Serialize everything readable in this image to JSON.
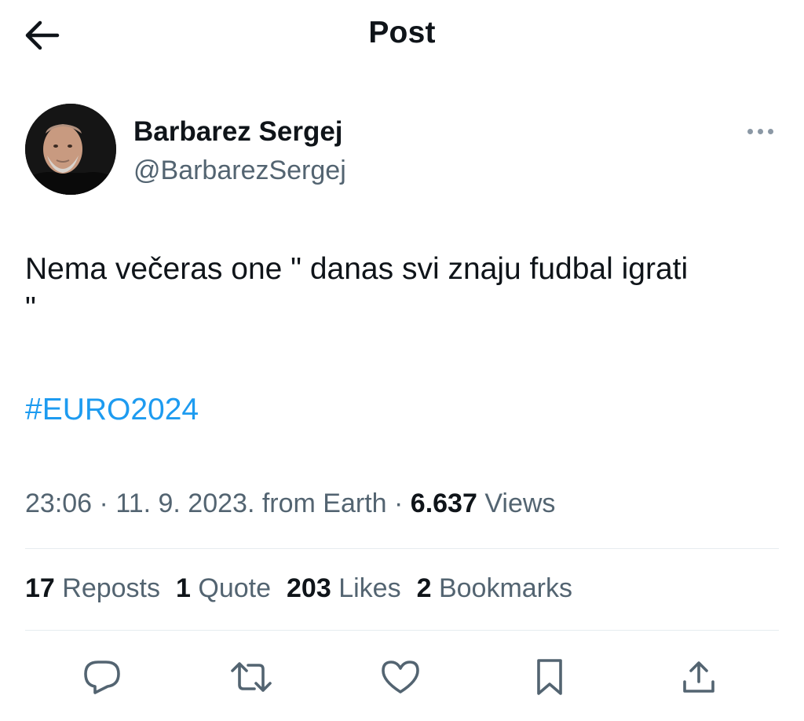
{
  "header": {
    "title": "Post",
    "back_icon": "arrow-left-icon"
  },
  "author": {
    "name": "Barbarez Sergej",
    "handle": "@BarbarezSergej",
    "more_icon": "more-horizontal-icon"
  },
  "post": {
    "text": "Nema večeras one \" danas svi znaju fudbal igrati\n\"",
    "hashtag": "#EURO2024"
  },
  "meta": {
    "time": "23:06",
    "sep1": " · ",
    "date": "11. 9. 2023.",
    "source": " from Earth",
    "sep2": " · ",
    "views_count": "6.637",
    "views_label": " Views"
  },
  "stats": [
    {
      "count": "17",
      "label": " Reposts"
    },
    {
      "count": "1",
      "label": " Quote"
    },
    {
      "count": "203",
      "label": " Likes"
    },
    {
      "count": "2",
      "label": " Bookmarks"
    }
  ],
  "actions": [
    {
      "icon": "reply-icon"
    },
    {
      "icon": "repost-icon"
    },
    {
      "icon": "like-icon"
    },
    {
      "icon": "bookmark-icon"
    },
    {
      "icon": "share-icon"
    }
  ],
  "colors": {
    "text": "#0f1419",
    "secondary": "#536471",
    "link": "#1d9bf0",
    "divider": "#e6ecf0"
  }
}
